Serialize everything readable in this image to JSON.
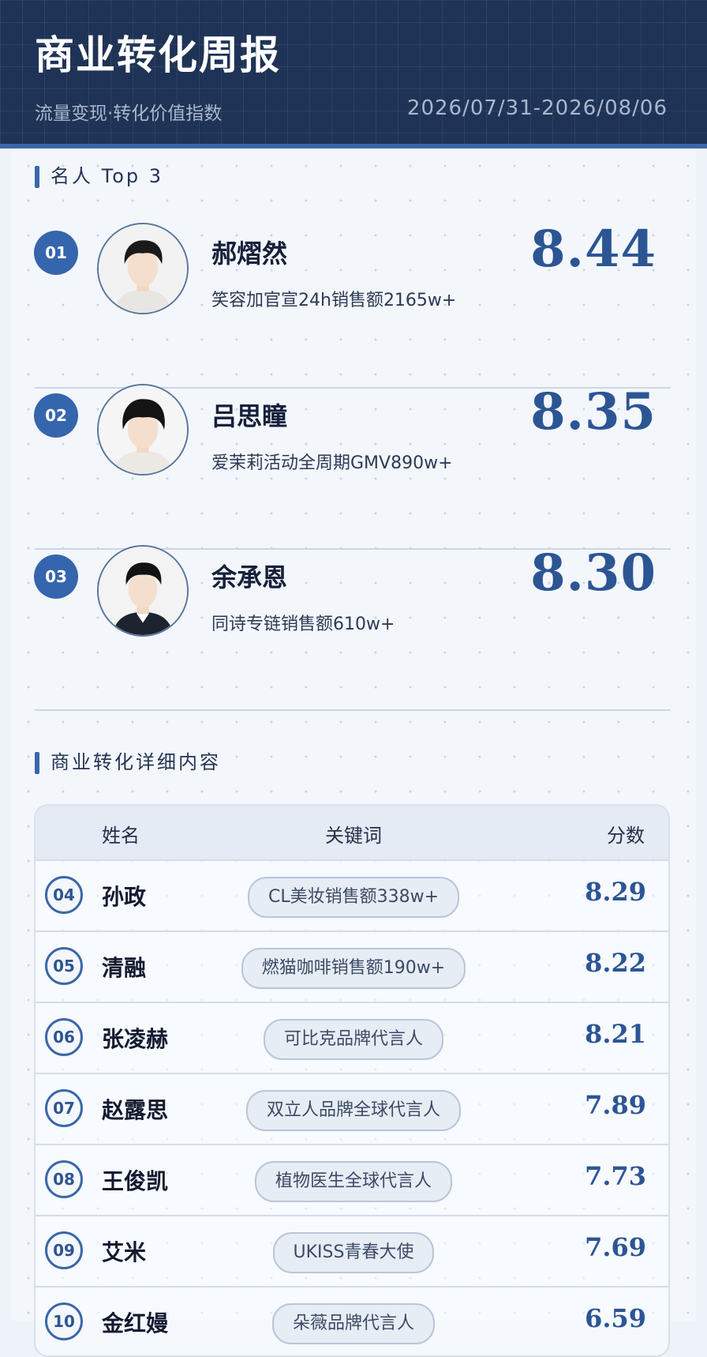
{
  "header": {
    "title": "商业转化周报",
    "subtitle": "流量变现·转化价值指数",
    "date_range": "2026/07/31-2026/08/06"
  },
  "top3": {
    "section_title": "名人 Top 3",
    "items": [
      {
        "rank": "01",
        "name": "郝熠然",
        "desc": "笑容加官宣24h销售额2165w+",
        "score": "8.44"
      },
      {
        "rank": "02",
        "name": "吕思瞳",
        "desc": "爱茉莉活动全周期GMV890w+",
        "score": "8.35"
      },
      {
        "rank": "03",
        "name": "余承恩",
        "desc": "同诗专链销售额610w+",
        "score": "8.30"
      }
    ]
  },
  "details": {
    "section_title": "商业转化详细内容",
    "headers": {
      "name": "姓名",
      "keyword": "关键词",
      "score": "分数"
    },
    "rows": [
      {
        "rank": "04",
        "name": "孙政",
        "keyword": "CL美妆销售额338w+",
        "score": "8.29"
      },
      {
        "rank": "05",
        "name": "清融",
        "keyword": "燃猫咖啡销售额190w+",
        "score": "8.22"
      },
      {
        "rank": "06",
        "name": "张凌赫",
        "keyword": "可比克品牌代言人",
        "score": "8.21"
      },
      {
        "rank": "07",
        "name": "赵露思",
        "keyword": "双立人品牌全球代言人",
        "score": "7.89"
      },
      {
        "rank": "08",
        "name": "王俊凯",
        "keyword": "植物医生全球代言人",
        "score": "7.73"
      },
      {
        "rank": "09",
        "name": "艾米",
        "keyword": "UKISS青春大使",
        "score": "7.69"
      },
      {
        "rank": "10",
        "name": "金红嫚",
        "keyword": "朵薇品牌代言人",
        "score": "6.59"
      }
    ]
  },
  "colors": {
    "header_bg": "#1f3356",
    "accent": "#3566ad",
    "score": "#2c5594",
    "page_bg": "#eef3f9"
  }
}
